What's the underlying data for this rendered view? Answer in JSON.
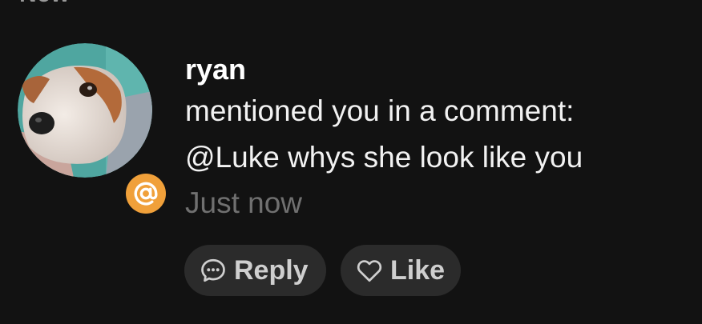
{
  "section": {
    "title": "New"
  },
  "notification": {
    "username": "ryan",
    "action_text": "mentioned you in a comment:",
    "comment_text": "@Luke whys she look like you",
    "timestamp": "Just now",
    "badge_icon": "at-sign-icon",
    "avatar_icon": "dog-photo-avatar",
    "accent_color": "#f0a03a"
  },
  "actions": {
    "reply_label": "Reply",
    "reply_icon": "speech-bubble-icon",
    "like_label": "Like",
    "like_icon": "heart-outline-icon"
  }
}
